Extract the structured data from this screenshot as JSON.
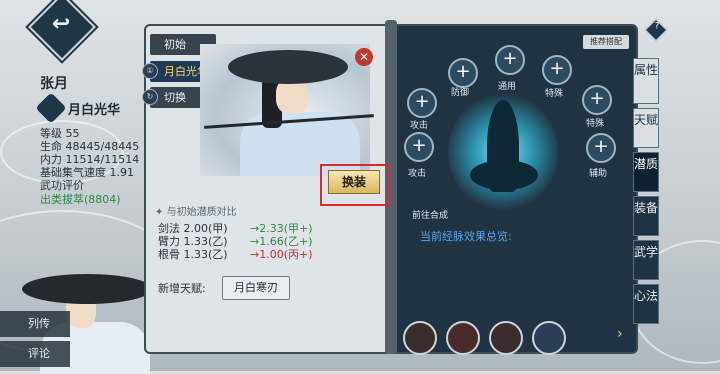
{
  "character": {
    "name": "张月",
    "title": "月白光华",
    "stats": [
      {
        "label": "等级 55"
      },
      {
        "label": "生命 48445/48445"
      },
      {
        "label": "内力 11514/11514"
      },
      {
        "label": "基础集气速度 1.91"
      },
      {
        "label": "武功评价"
      },
      {
        "label": "出类拔萃(8804)"
      }
    ]
  },
  "side_buttons": [
    "列传",
    "评论"
  ],
  "left_panel": {
    "tags": [
      {
        "label": "初始"
      },
      {
        "label": "月白光华",
        "icon": "①"
      },
      {
        "label": "切换"
      }
    ],
    "swap_label": "换装",
    "compare_title": "与初始潜质对比",
    "compare_rows": [
      {
        "name": "剑法 2.00(甲)",
        "value": "→2.33(甲+)",
        "dir": "up"
      },
      {
        "name": "臂力 1.33(乙)",
        "value": "→1.66(乙+)",
        "dir": "up"
      },
      {
        "name": "根骨 1.33(乙)",
        "value": "→1.00(丙+)",
        "dir": "down"
      }
    ],
    "talent_label": "新增天赋:",
    "talent_value": "月白寒刃"
  },
  "right_panel": {
    "recommend_label": "推荐搭配",
    "nodes": [
      {
        "label": "防御"
      },
      {
        "label": "通用"
      },
      {
        "label": "特殊"
      },
      {
        "label": "攻击"
      },
      {
        "label": "特殊"
      },
      {
        "label": "攻击"
      },
      {
        "label": "辅助"
      }
    ],
    "synth_label": "前往合成",
    "overview_label": "当前经脉效果总览:"
  },
  "tabs": [
    "属性",
    "天赋",
    "潜质",
    "装备",
    "武学",
    "心法"
  ],
  "colors": {
    "accent": "#1f3342",
    "highlight": "#e0272b",
    "up": "#2e8a3d",
    "down": "#d0283a"
  }
}
